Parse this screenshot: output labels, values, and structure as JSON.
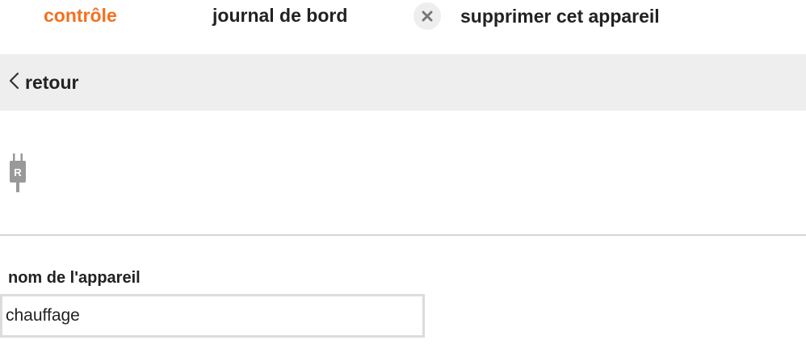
{
  "tabs": {
    "control_label": "contrôle",
    "journal_label": "journal de bord",
    "delete_label": "supprimer cet appareil"
  },
  "back_bar": {
    "back_label": "retour"
  },
  "device": {
    "icon": "plug-icon",
    "icon_letter": "R"
  },
  "form": {
    "name_label": "nom de l'appareil",
    "name_value": "chauffage"
  },
  "colors": {
    "accent": "#f37021",
    "bar_background": "#eeeeee",
    "icon_gray": "#999999"
  }
}
